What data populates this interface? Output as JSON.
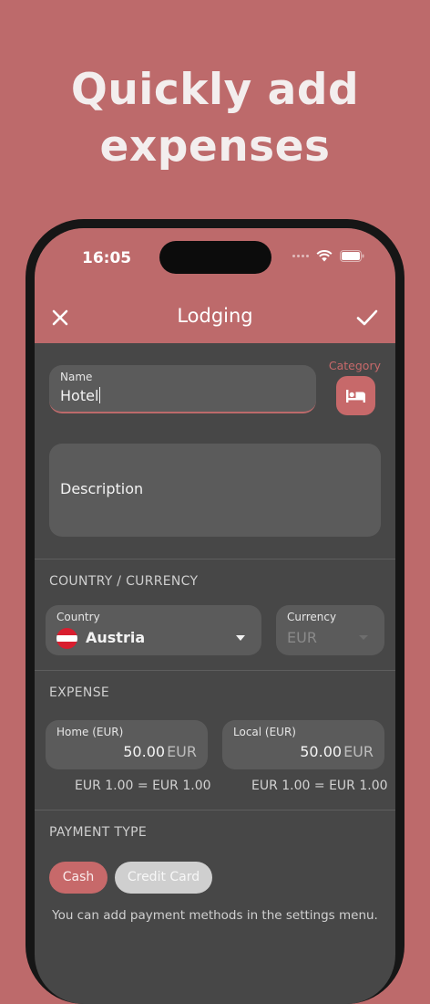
{
  "headline": {
    "line1": "Quickly add",
    "line2": "expenses"
  },
  "status_bar": {
    "time": "16:05"
  },
  "app_bar": {
    "title": "Lodging"
  },
  "name_field": {
    "label": "Name",
    "value": "Hotel"
  },
  "category": {
    "label": "Category",
    "icon": "bed-icon"
  },
  "description_field": {
    "placeholder": "Description"
  },
  "country_currency": {
    "section_title": "COUNTRY / CURRENCY",
    "country_label": "Country",
    "country_value": "Austria",
    "currency_label": "Currency",
    "currency_value": "EUR"
  },
  "expense": {
    "section_title": "EXPENSE",
    "home_label": "Home (EUR)",
    "home_amount": "50.00",
    "home_currency": "EUR",
    "home_rate": "EUR 1.00 = EUR 1.00",
    "local_label": "Local (EUR)",
    "local_amount": "50.00",
    "local_currency": "EUR",
    "local_rate": "EUR 1.00 = EUR 1.00"
  },
  "payment": {
    "section_title": "PAYMENT TYPE",
    "cash_label": "Cash",
    "credit_label": "Credit Card",
    "hint": "You can add payment methods in the settings menu."
  },
  "colors": {
    "accent": "#bd6a6b",
    "surface": "#474747",
    "field": "#5b5b5b"
  }
}
